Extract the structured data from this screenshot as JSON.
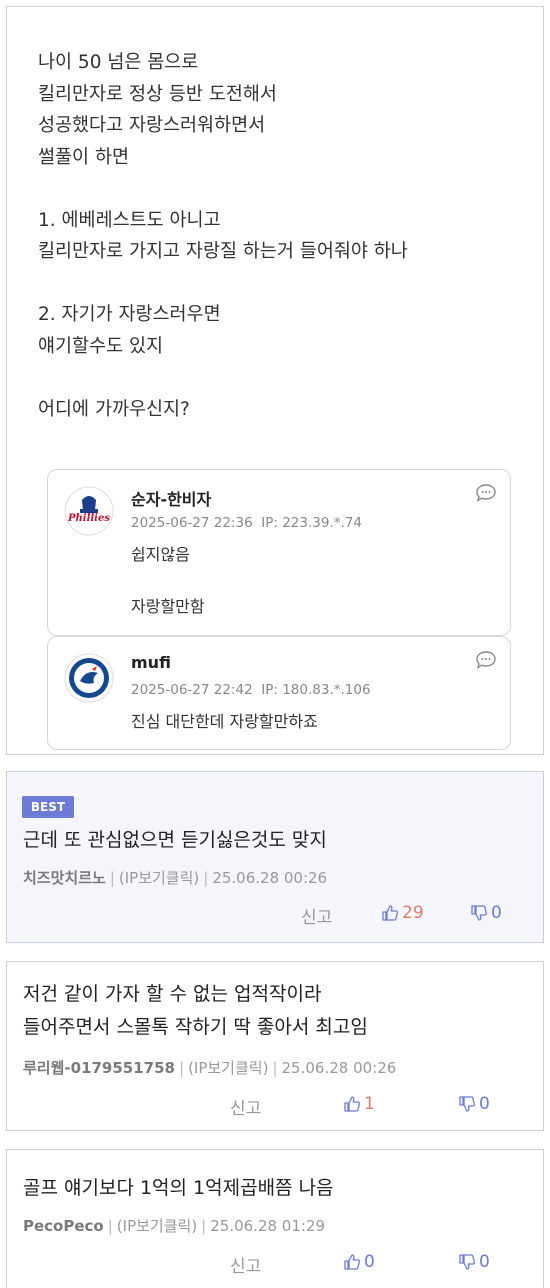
{
  "post": {
    "lines": [
      "나이 50 넘은 몸으로",
      "킬리만자로 정상 등반 도전해서",
      "성공했다고 자랑스러워하면서",
      "썰풀이 하면",
      "",
      "1. 에베레스트도 아니고",
      "킬리만자로 가지고 자랑질 하는거 들어줘야 하나",
      "",
      "2. 자기가 자랑스러우면",
      "얘기할수도 있지",
      "",
      "어디에 가까우신지?"
    ]
  },
  "embedded_comments": [
    {
      "name": "순자-한비자",
      "date": "2025-06-27 22:36",
      "ip": "IP: 223.39.*.74",
      "text_lines": [
        "쉽지않음",
        "",
        "자랑할만함"
      ],
      "avatar": "phillies-logo",
      "avatar_text": "Phillies"
    },
    {
      "name": "mufi",
      "date": "2025-06-27 22:42",
      "ip": "IP: 180.83.*.106",
      "text_lines": [
        "진심 대단한데 자랑할만하죠"
      ],
      "avatar": "blue-jays-logo"
    }
  ],
  "replies": [
    {
      "best_label": "BEST",
      "text_lines": [
        "근데 또 관심없으면 듣기싫은것도 맞지"
      ],
      "nick": "치즈맛치르노",
      "ip_label": "(IP보기클릭)",
      "date": "25.06.28 00:26",
      "report": "신고",
      "likes": "29",
      "dislikes": "0"
    },
    {
      "text_lines": [
        "저건 같이 가자 할 수 없는 업적작이라",
        "들어주면서 스몰톡 작하기 딱 좋아서 최고임"
      ],
      "nick": "루리웹-0179551758",
      "ip_label": "(IP보기클릭)",
      "date": "25.06.28 00:26",
      "report": "신고",
      "likes": "1",
      "dislikes": "0"
    },
    {
      "text_lines": [
        "골프 얘기보다 1억의 1억제곱배쯤 나음"
      ],
      "nick": "PecoPeco",
      "ip_label": "(IP보기클릭)",
      "date": "25.06.28 01:29",
      "report": "신고",
      "likes": "0",
      "dislikes": "0"
    }
  ],
  "colors": {
    "accent": "#6b7bd6",
    "like_hot": "#e07a6e",
    "best_bg": "#f4f6fb"
  }
}
